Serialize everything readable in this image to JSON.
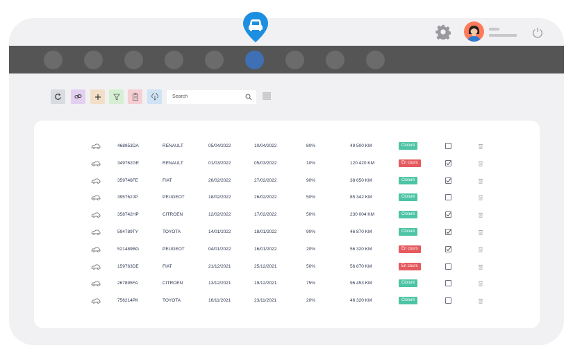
{
  "toolbar": {
    "search_placeholder": "Search",
    "buttons": [
      {
        "icon": "refresh-icon",
        "color": "#d8dbe0"
      },
      {
        "icon": "link-icon",
        "color": "#e3d0f1"
      },
      {
        "icon": "plus-icon",
        "color": "#f3dfc8"
      },
      {
        "icon": "filter-icon",
        "color": "#d5efd2"
      },
      {
        "icon": "clipboard-icon",
        "color": "#f5cfd3"
      },
      {
        "icon": "cloud-download-icon",
        "color": "#cfe3f5"
      }
    ]
  },
  "nav": {
    "items": 9,
    "active_index": 5
  },
  "colors": {
    "navbar": "#555555",
    "accent": "#3f6fb5",
    "pin": "#1d8fe0",
    "closed": "#4cc4a5",
    "in_progress": "#e55a5f"
  },
  "rows": [
    {
      "id": "468953DA",
      "brand": "RENAULT",
      "start": "05/04/2022",
      "end": "10/04/2022",
      "percent": "80%",
      "km": "49 500 KM",
      "status": "Cloturé",
      "status_type": "closed",
      "checked": false
    },
    {
      "id": "349762GE",
      "brand": "RENAULT",
      "start": "01/03/2022",
      "end": "05/03/2022",
      "percent": "10%",
      "km": "120 420 KM",
      "status": "En cours",
      "status_type": "in_progress",
      "checked": true
    },
    {
      "id": "359746FE",
      "brand": "FIAT",
      "start": "26/02/2022",
      "end": "27/02/2022",
      "percent": "90%",
      "km": "38 650 KM",
      "status": "Cloturé",
      "status_type": "closed",
      "checked": true
    },
    {
      "id": "395762JP",
      "brand": "PEUGEOT",
      "start": "18/02/2022",
      "end": "26/02/2022",
      "percent": "50%",
      "km": "85 342 KM",
      "status": "Cloturé",
      "status_type": "closed",
      "checked": false
    },
    {
      "id": "358742HP",
      "brand": "CITROEN",
      "start": "12/02/2022",
      "end": "17/02/2022",
      "percent": "50%",
      "km": "230 004 KM",
      "status": "Cloturé",
      "status_type": "closed",
      "checked": true
    },
    {
      "id": "594789TY",
      "brand": "TOYOTA",
      "start": "14/01/2022",
      "end": "18/01/2022",
      "percent": "90%",
      "km": "46 870 KM",
      "status": "Cloturé",
      "status_type": "closed",
      "checked": true
    },
    {
      "id": "521489BG",
      "brand": "PEUGEOT",
      "start": "04/01/2022",
      "end": "16/01/2022",
      "percent": "20%",
      "km": "56 320 KM",
      "status": "En cours",
      "status_type": "in_progress",
      "checked": true
    },
    {
      "id": "159763DE",
      "brand": "FIAT",
      "start": "21/12/2021",
      "end": "25/12/2021",
      "percent": "50%",
      "km": "56 870 KM",
      "status": "En cours",
      "status_type": "in_progress",
      "checked": false
    },
    {
      "id": "267895FA",
      "brand": "CITROEN",
      "start": "13/12/2021",
      "end": "19/12/2021",
      "percent": "75%",
      "km": "96 453 KM",
      "status": "Cloturé",
      "status_type": "closed",
      "checked": false
    },
    {
      "id": "756214PK",
      "brand": "TOYOTA",
      "start": "16/11/2021",
      "end": "23/11/2021",
      "percent": "20%",
      "km": "46 320 KM",
      "status": "Cloturé",
      "status_type": "closed",
      "checked": false
    }
  ]
}
